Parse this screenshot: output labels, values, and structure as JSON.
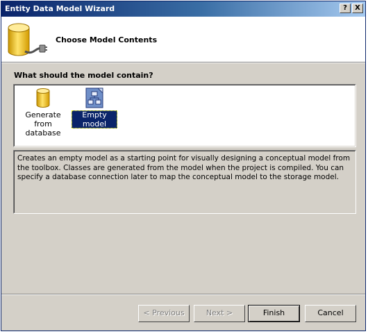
{
  "window": {
    "title": "Entity Data Model Wizard",
    "help_glyph": "?",
    "close_glyph": "X"
  },
  "header": {
    "title": "Choose Model Contents",
    "icon": "database-plug-icon"
  },
  "prompt": "What should the model contain?",
  "options": [
    {
      "label": "Generate from database",
      "icon": "database-icon",
      "selected": false
    },
    {
      "label": "Empty model",
      "icon": "empty-model-icon",
      "selected": true
    }
  ],
  "option_labels": {
    "generate_line1": "Generate from",
    "generate_line2": "database",
    "empty": "Empty model"
  },
  "description": "Creates an empty model as a starting point for visually designing a conceptual model from the toolbox. Classes are generated from the model when the project is compiled. You can specify a database connection later to map the conceptual model to the storage model.",
  "buttons": {
    "previous": "< Previous",
    "next": "Next >",
    "finish": "Finish",
    "cancel": "Cancel"
  },
  "colors": {
    "titlebar_start": "#0a246a",
    "titlebar_end": "#a6caf0",
    "dialog_bg": "#d4d0c8",
    "selection": "#0a246a"
  }
}
